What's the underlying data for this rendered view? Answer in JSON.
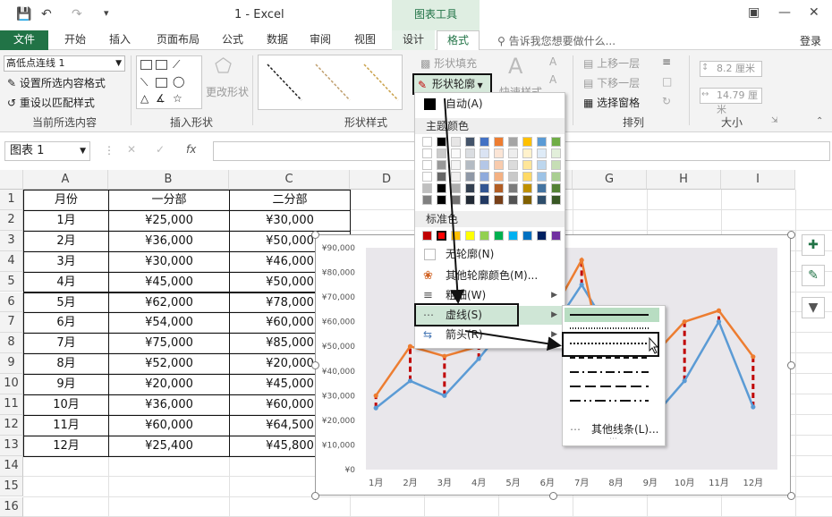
{
  "titlebar": {
    "title": "1 - Excel",
    "context_tools": "图表工具"
  },
  "tabs": [
    "文件",
    "开始",
    "插入",
    "页面布局",
    "公式",
    "数据",
    "审阅",
    "视图",
    "设计",
    "格式"
  ],
  "tellme": "告诉我您想要做什么...",
  "login": "登录",
  "ribbon": {
    "selection_combo": "高低点连线 1",
    "format_selection": "设置所选内容格式",
    "reset_style": "重设以匹配样式",
    "group_current": "当前所选内容",
    "change_shape": "更改形状",
    "group_insert_shapes": "插入形状",
    "group_shape_styles": "形状样式",
    "shape_fill": "形状填充",
    "shape_outline": "形状轮廓",
    "quick_styles": "快速样式",
    "bring_forward": "上移一层",
    "send_backward": "下移一层",
    "selection_pane": "选择窗格",
    "group_arrange": "排列",
    "height": "8.2 厘米",
    "width": "14.79 厘米",
    "group_size": "大小"
  },
  "formula_bar": {
    "name_box": "图表 1",
    "fx": "fx"
  },
  "sheet": {
    "columns": [
      "A",
      "B",
      "C",
      "D",
      "E",
      "F",
      "G",
      "H",
      "I"
    ],
    "rows": [
      "1",
      "2",
      "3",
      "4",
      "5",
      "6",
      "7",
      "8",
      "9",
      "10",
      "11",
      "12",
      "13",
      "14",
      "15",
      "16"
    ],
    "header": [
      "月份",
      "一分部",
      "二分部"
    ],
    "data": [
      [
        "1月",
        "¥25,000",
        "¥30,000"
      ],
      [
        "2月",
        "¥36,000",
        "¥50,000"
      ],
      [
        "3月",
        "¥30,000",
        "¥46,000"
      ],
      [
        "4月",
        "¥45,000",
        "¥50,000"
      ],
      [
        "5月",
        "¥62,000",
        "¥78,000"
      ],
      [
        "6月",
        "¥54,000",
        "¥60,000"
      ],
      [
        "7月",
        "¥75,000",
        "¥85,000"
      ],
      [
        "8月",
        "¥52,000",
        "¥20,000"
      ],
      [
        "9月",
        "¥20,000",
        "¥45,000"
      ],
      [
        "10月",
        "¥36,000",
        "¥60,000"
      ],
      [
        "11月",
        "¥60,000",
        "¥64,500"
      ],
      [
        "12月",
        "¥25,400",
        "¥45,800"
      ]
    ]
  },
  "chart_data": {
    "type": "line",
    "categories": [
      "1月",
      "2月",
      "3月",
      "4月",
      "5月",
      "6月",
      "7月",
      "8月",
      "9月",
      "10月",
      "11月",
      "12月"
    ],
    "y_tick_labels": [
      "¥0",
      "¥10,000",
      "¥20,000",
      "¥30,000",
      "¥40,000",
      "¥50,000",
      "¥60,000",
      "¥70,000",
      "¥80,000",
      "¥90,000"
    ],
    "ylim": [
      0,
      90000
    ],
    "series": [
      {
        "values": [
          25000,
          36000,
          30000,
          45000,
          62000,
          54000,
          75000,
          52000,
          20000,
          36000,
          60000,
          25400
        ],
        "color": "#5b9bd5"
      },
      {
        "values": [
          30000,
          50000,
          46000,
          50000,
          78000,
          60000,
          85000,
          20000,
          45000,
          60000,
          64500,
          45800
        ],
        "color": "#ed7d31"
      }
    ],
    "high_low_lines": true,
    "high_low_color": "#c00000"
  },
  "dropdown": {
    "auto": "自动(A)",
    "theme_colors": "主题颜色",
    "standard_colors": "标准色",
    "no_outline": "无轮廓(N)",
    "more_colors": "其他轮廓颜色(M)...",
    "weight": "粗细(W)",
    "dashes": "虚线(S)",
    "arrows": "箭头(R)",
    "more_lines": "其他线条(L)...",
    "theme_top": [
      "#ffffff",
      "#000000",
      "#e7e6e6",
      "#44546a",
      "#4472c4",
      "#ed7d31",
      "#a5a5a5",
      "#ffc000",
      "#5b9bd5",
      "#70ad47"
    ],
    "standard": [
      "#c00000",
      "#ff0000",
      "#ffc000",
      "#ffff00",
      "#92d050",
      "#00b050",
      "#00b0f0",
      "#0070c0",
      "#002060",
      "#7030a0"
    ]
  }
}
